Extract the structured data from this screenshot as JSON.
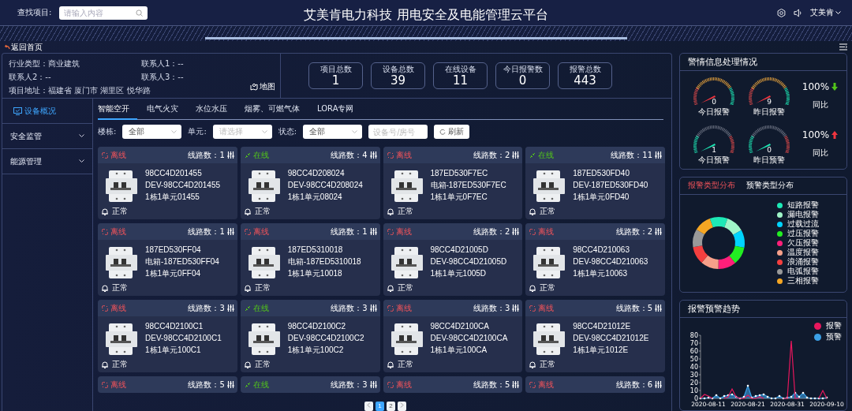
{
  "header": {
    "search_label": "查找项目:",
    "search": {
      "placeholder": "请输入内容"
    },
    "title": "艾美肯电力科技 用电安全及电能管理云平台",
    "user": "艾美肯"
  },
  "back_link": "返回首页",
  "project_info": {
    "fields": [
      "行业类型：商业建筑",
      "联系人1：--",
      "联系人2：--",
      "联系人3：--",
      "项目地址：福建省 厦门市 湖里区 悦华路"
    ],
    "map_link": "地图"
  },
  "stats": [
    {
      "label": "项目总数",
      "value": "1"
    },
    {
      "label": "设备总数",
      "value": "39"
    },
    {
      "label": "在线设备",
      "value": "11"
    },
    {
      "label": "今日报警数",
      "value": "0"
    },
    {
      "label": "报警总数",
      "value": "443"
    }
  ],
  "sidebar": {
    "items": [
      {
        "label": "设备概况",
        "selected": true,
        "expandable": false
      },
      {
        "label": "安全监管",
        "selected": false,
        "expandable": true
      },
      {
        "label": "能源管理",
        "selected": false,
        "expandable": true
      }
    ]
  },
  "tabs": [
    {
      "label": "智能空开",
      "selected": true
    },
    {
      "label": "电气火灾",
      "selected": false
    },
    {
      "label": "水位水压",
      "selected": false
    },
    {
      "label": "烟雾、可燃气体",
      "selected": false
    },
    {
      "label": "LORA专网",
      "selected": false
    }
  ],
  "filters": {
    "building": {
      "label": "楼栋:",
      "value": "全部"
    },
    "unit": {
      "label": "单元:",
      "placeholder": "请选择"
    },
    "status": {
      "label": "状态:",
      "value": "全部"
    },
    "search": {
      "placeholder": "设备号/房号"
    },
    "refresh": "刷新"
  },
  "devices": [
    {
      "status": "离线",
      "online": false,
      "lines": "线路数：1",
      "id": "98CC4D201455",
      "name": "DEV-98CC4D201455",
      "location": "1栋1单元01455",
      "alarm": "正常"
    },
    {
      "status": "在线",
      "online": true,
      "lines": "线路数：4",
      "id": "98CC4D208024",
      "name": "DEV-98CC4D208024",
      "location": "1栋1单元08024",
      "alarm": "正常"
    },
    {
      "status": "离线",
      "online": false,
      "lines": "线路数：2",
      "id": "187ED530F7EC",
      "name": "电箱-187ED530F7EC",
      "location": "1栋1单元0F7EC",
      "alarm": "正常"
    },
    {
      "status": "在线",
      "online": true,
      "lines": "线路数：11",
      "id": "187ED530FD40",
      "name": "DEV-187ED530FD40",
      "location": "1栋1单元0FD40",
      "alarm": "正常"
    },
    {
      "status": "离线",
      "online": false,
      "lines": "线路数：1",
      "id": "187ED530FF04",
      "name": "电箱-187ED530FF04",
      "location": "1栋1单元0FF04",
      "alarm": "正常"
    },
    {
      "status": "离线",
      "online": false,
      "lines": "线路数：1",
      "id": "187ED5310018",
      "name": "电箱-187ED5310018",
      "location": "1栋1单元10018",
      "alarm": "正常"
    },
    {
      "status": "离线",
      "online": false,
      "lines": "线路数：2",
      "id": "98CC4D21005D",
      "name": "DEV-98CC4D21005D",
      "location": "1栋1单元1005D",
      "alarm": "正常"
    },
    {
      "status": "离线",
      "online": false,
      "lines": "线路数：2",
      "id": "98CC4D210063",
      "name": "DEV-98CC4D210063",
      "location": "1栋1单元10063",
      "alarm": "正常"
    },
    {
      "status": "离线",
      "online": false,
      "lines": "线路数：3",
      "id": "98CC4D2100C1",
      "name": "DEV-98CC4D2100C1",
      "location": "1栋1单元100C1",
      "alarm": "正常"
    },
    {
      "status": "在线",
      "online": true,
      "lines": "线路数：3",
      "id": "98CC4D2100C2",
      "name": "DEV-98CC4D2100C2",
      "location": "1栋1单元100C2",
      "alarm": "正常"
    },
    {
      "status": "离线",
      "online": false,
      "lines": "线路数：3",
      "id": "98CC4D2100CA",
      "name": "DEV-98CC4D2100CA",
      "location": "1栋1单元100CA",
      "alarm": "正常"
    },
    {
      "status": "离线",
      "online": false,
      "lines": "线路数：5",
      "id": "98CC4D21012E",
      "name": "DEV-98CC4D21012E",
      "location": "1栋1单元1012E",
      "alarm": "正常"
    },
    {
      "status": "离线",
      "online": false,
      "lines": "线路数：5"
    },
    {
      "status": "在线",
      "online": true,
      "lines": "线路数：3"
    },
    {
      "status": "离线",
      "online": false,
      "lines": "线路数：5"
    },
    {
      "status": "离线",
      "online": false,
      "lines": "线路数：6"
    }
  ],
  "pagination": [
    {
      "label": "1",
      "selected": true
    },
    {
      "label": "2",
      "selected": false
    }
  ],
  "alarm_panel": {
    "title": "警情信息处理情况",
    "rows": [
      {
        "gauges": [
          {
            "kind": "alarm",
            "value": "0",
            "label": "今日报警"
          },
          {
            "kind": "alarm",
            "value": "9",
            "label": "昨日报警"
          }
        ],
        "compare": {
          "value": "100%",
          "rising": false,
          "label": "同比"
        }
      },
      {
        "gauges": [
          {
            "kind": "warning",
            "value": "1",
            "label": "今日预警"
          },
          {
            "kind": "warning",
            "value": "0",
            "label": "昨日预警"
          }
        ],
        "compare": {
          "value": "100%",
          "rising": true,
          "label": "同比"
        }
      }
    ]
  },
  "distribution": {
    "tabs": [
      {
        "label": "报警类型分布",
        "selected": true
      },
      {
        "label": "预警类型分布",
        "selected": false
      }
    ],
    "legend": [
      {
        "label": "短路报警",
        "color": "#1de9b6"
      },
      {
        "label": "漏电报警",
        "color": "#9ff5c8"
      },
      {
        "label": "过载过流",
        "color": "#00d4ff"
      },
      {
        "label": "过压报警",
        "color": "#22ee22"
      },
      {
        "label": "欠压报警",
        "color": "#ff1f7a"
      },
      {
        "label": "温度报警",
        "color": "#f7a08a"
      },
      {
        "label": "浪涌报警",
        "color": "#f43f3f"
      },
      {
        "label": "电弧报警",
        "color": "#999999"
      },
      {
        "label": "三相报警",
        "color": "#f5a623"
      }
    ]
  },
  "trend": {
    "title": "报警预警趋势",
    "chart_data": {
      "type": "line",
      "categories": [
        null,
        null,
        "2020-08-11",
        null,
        null,
        null,
        null,
        null,
        null,
        null,
        null,
        null,
        "2020-08-21",
        null,
        null,
        null,
        null,
        null,
        null,
        null,
        null,
        null,
        "2020-08-31",
        null,
        null,
        null,
        null,
        null,
        null,
        null,
        null,
        null,
        "2020-09-10"
      ],
      "legend": "top-right",
      "ylim": [
        0,
        80
      ],
      "yticks": [
        0,
        10,
        20,
        30,
        40,
        50,
        60,
        70,
        80
      ],
      "series": [
        {
          "name": "报警",
          "color": "#e8175d",
          "values": [
            0,
            5,
            3,
            0,
            null,
            null,
            0,
            2,
            12,
            2,
            0,
            0,
            4,
            0,
            0,
            2,
            0,
            null,
            null,
            null,
            null,
            0,
            0,
            73,
            0,
            0,
            null,
            null,
            null,
            null,
            0,
            10,
            0
          ]
        },
        {
          "name": "预警",
          "color": "#3ba0e6",
          "values": [
            0,
            0,
            1,
            0,
            4,
            0,
            3,
            4,
            5,
            2,
            0,
            2,
            16,
            1,
            3,
            4,
            5,
            2,
            0,
            0,
            3,
            0,
            1,
            2,
            7,
            2,
            7,
            1,
            0,
            0,
            0,
            0,
            1
          ]
        }
      ]
    }
  }
}
